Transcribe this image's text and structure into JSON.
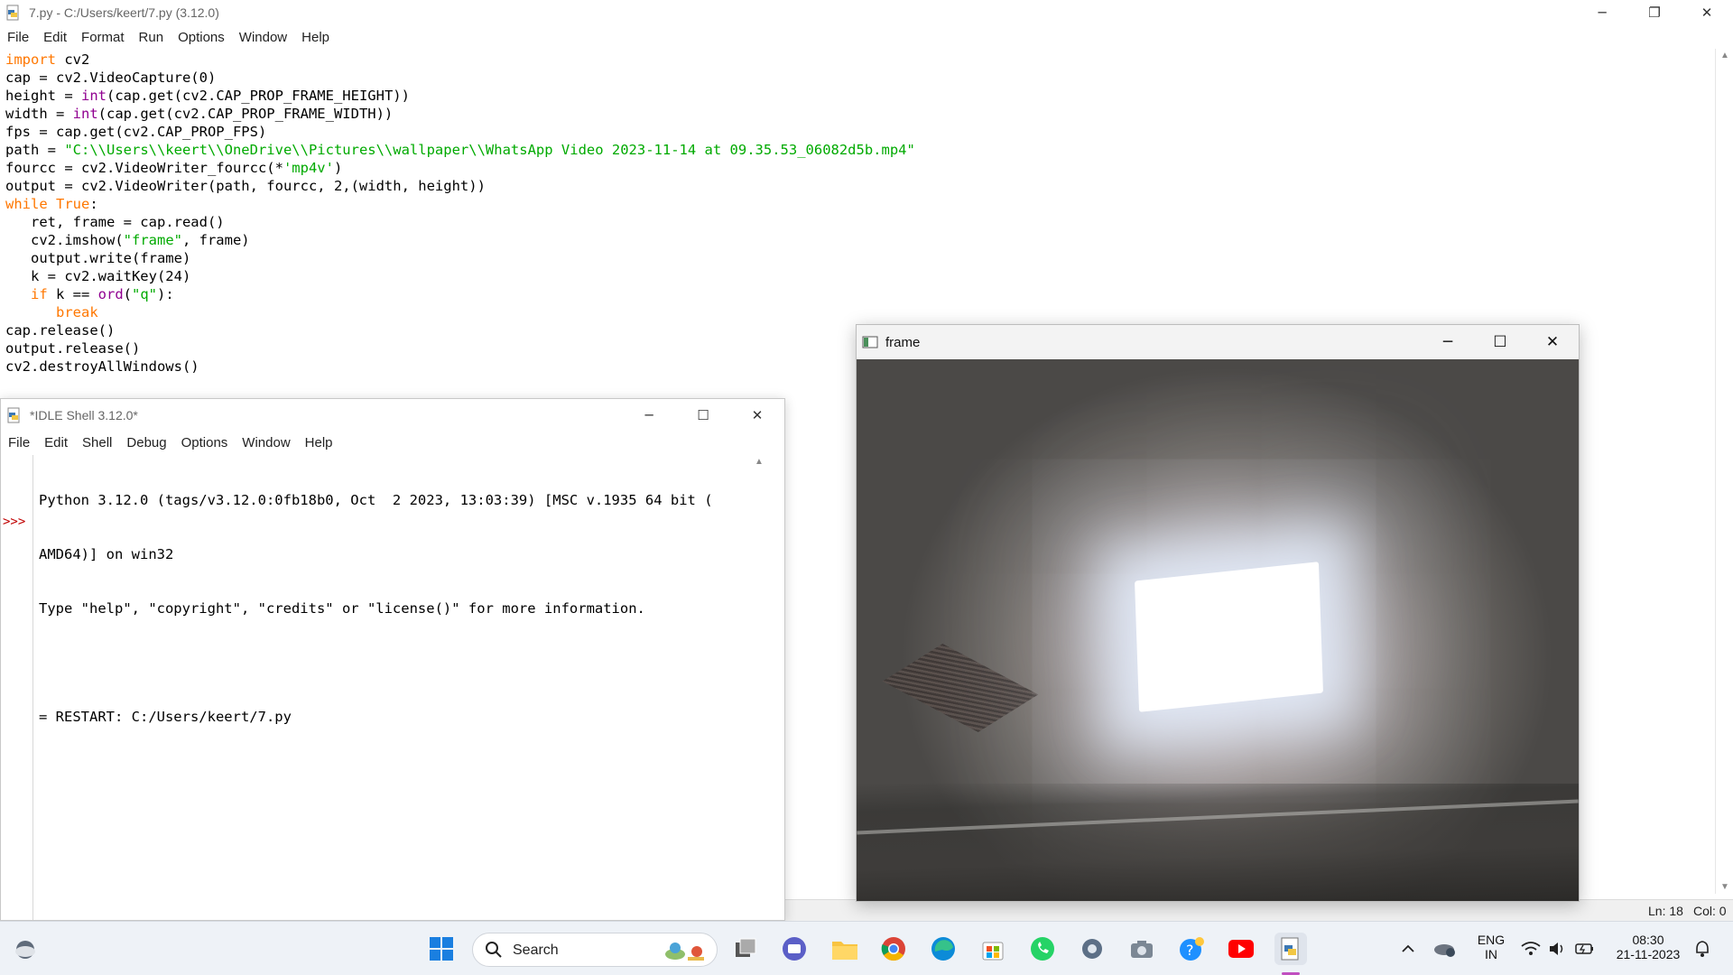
{
  "editor": {
    "title": "7.py - C:/Users/keert/7.py (3.12.0)",
    "menu": [
      "File",
      "Edit",
      "Format",
      "Run",
      "Options",
      "Window",
      "Help"
    ],
    "status_line": "Ln: 18",
    "status_col": "Col: 0"
  },
  "shell": {
    "title": "*IDLE Shell 3.12.0*",
    "menu": [
      "File",
      "Edit",
      "Shell",
      "Debug",
      "Options",
      "Window",
      "Help"
    ],
    "prompt": ">>>",
    "lines": [
      "Python 3.12.0 (tags/v3.12.0:0fb18b0, Oct  2 2023, 13:03:39) [MSC v.1935 64 bit (",
      "AMD64)] on win32",
      "Type \"help\", \"copyright\", \"credits\" or \"license()\" for more information.",
      "",
      "= RESTART: C:/Users/keert/7.py"
    ]
  },
  "frame_window": {
    "title": "frame"
  },
  "taskbar": {
    "search_label": "Search",
    "lang_top": "ENG",
    "lang_bottom": "IN",
    "time": "08:30",
    "date": "21-11-2023"
  },
  "code_tokens": [
    [
      [
        "kw",
        "import"
      ],
      [
        "n",
        " cv2"
      ]
    ],
    [
      [
        "n",
        "cap = cv2.VideoCapture(0)"
      ]
    ],
    [
      [
        "n",
        "height = "
      ],
      [
        "bi",
        "int"
      ],
      [
        "n",
        "(cap.get(cv2.CAP_PROP_FRAME_HEIGHT))"
      ]
    ],
    [
      [
        "n",
        "width = "
      ],
      [
        "bi",
        "int"
      ],
      [
        "n",
        "(cap.get(cv2.CAP_PROP_FRAME_WIDTH))"
      ]
    ],
    [
      [
        "n",
        "fps = cap.get(cv2.CAP_PROP_FPS)"
      ]
    ],
    [
      [
        "n",
        "path = "
      ],
      [
        "st",
        "\"C:\\\\Users\\\\keert\\\\OneDrive\\\\Pictures\\\\wallpaper\\\\WhatsApp Video 2023-11-14 at 09.35.53_06082d5b.mp4\""
      ]
    ],
    [
      [
        "n",
        "fourcc = cv2.VideoWriter_fourcc(*"
      ],
      [
        "st",
        "'mp4v'"
      ],
      [
        "n",
        ")"
      ]
    ],
    [
      [
        "n",
        "output = cv2.VideoWriter(path, fourcc, 2,(width, height))"
      ]
    ],
    [
      [
        "kw",
        "while"
      ],
      [
        "n",
        " "
      ],
      [
        "kw",
        "True"
      ],
      [
        "n",
        ":"
      ]
    ],
    [
      [
        "n",
        "   ret, frame = cap.read()"
      ]
    ],
    [
      [
        "n",
        "   cv2.imshow("
      ],
      [
        "st",
        "\"frame\""
      ],
      [
        "n",
        ", frame)"
      ]
    ],
    [
      [
        "n",
        "   output.write(frame)"
      ]
    ],
    [
      [
        "n",
        "   k = cv2.waitKey(24)"
      ]
    ],
    [
      [
        "n",
        "   "
      ],
      [
        "kw",
        "if"
      ],
      [
        "n",
        " k == "
      ],
      [
        "bi",
        "ord"
      ],
      [
        "n",
        "("
      ],
      [
        "st",
        "\"q\""
      ],
      [
        "n",
        "):"
      ]
    ],
    [
      [
        "n",
        "      "
      ],
      [
        "kw",
        "break"
      ]
    ],
    [
      [
        "n",
        "cap.release()"
      ]
    ],
    [
      [
        "n",
        "output.release()"
      ]
    ],
    [
      [
        "n",
        "cv2.destroyAllWindows()"
      ]
    ]
  ],
  "icons": {
    "editor_app": "python-file-icon",
    "shell_app": "python-shell-icon",
    "frame_app": "opencv-window-icon"
  }
}
